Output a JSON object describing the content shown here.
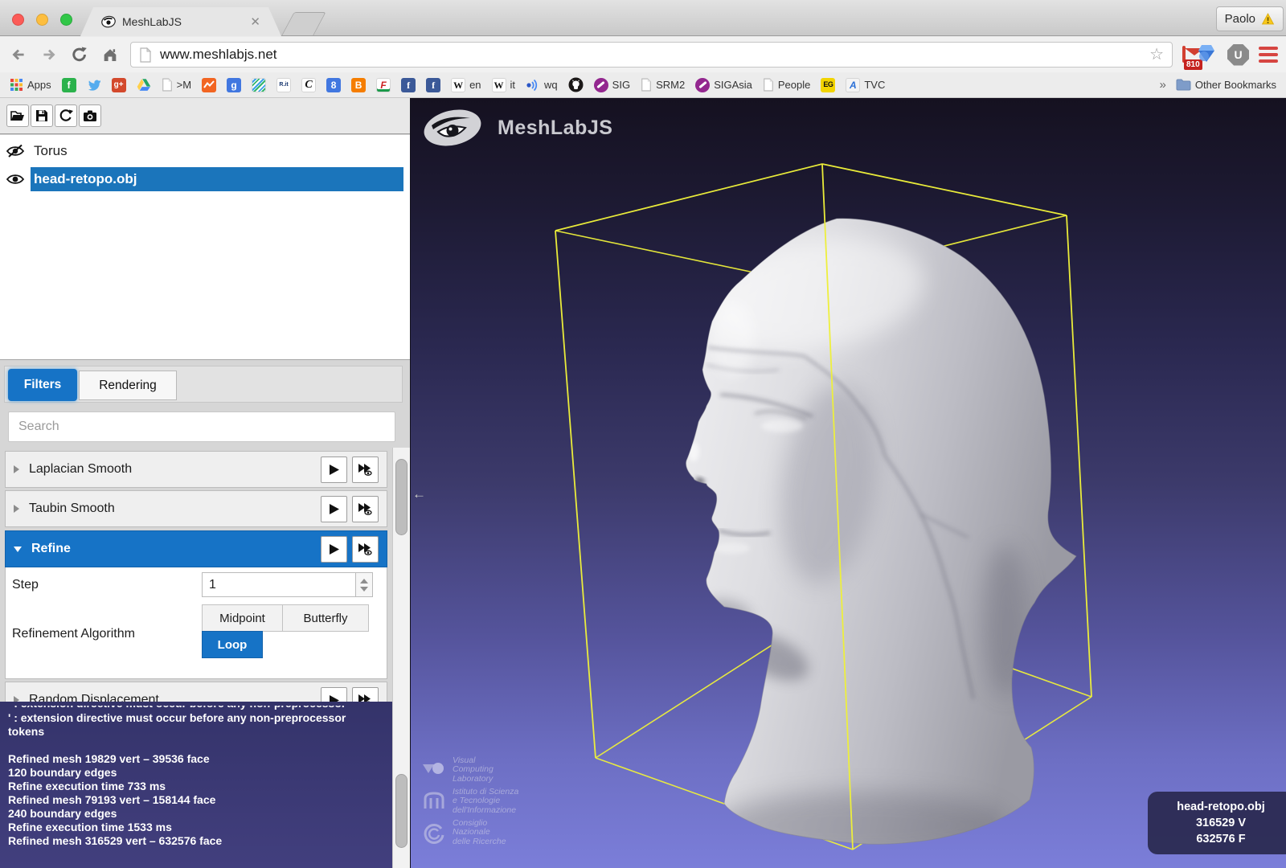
{
  "colors": {
    "accent_blue": "#1673c6",
    "selection_blue": "#1b75bb",
    "bbox_yellow": "#eef03a",
    "log_bg": "#38366e",
    "viewport_top": "#151120",
    "viewport_bottom": "#7b7ed9"
  },
  "browser": {
    "tab_title": "MeshLabJS",
    "url": "www.meshlabjs.net",
    "profile_label": "Paolo",
    "gmail_badge": "810",
    "ublock_letter": "U",
    "overflow_chevron": "»",
    "bookmarks": [
      {
        "icon": "apps-grid",
        "label": "Apps"
      },
      {
        "icon": "feedly",
        "glyph": "f"
      },
      {
        "icon": "twitter"
      },
      {
        "icon": "google-plus",
        "glyph": "g+"
      },
      {
        "icon": "google-drive"
      },
      {
        "icon": "doc",
        "label": ">M"
      },
      {
        "icon": "analytics"
      },
      {
        "icon": "google-g",
        "glyph": "g"
      },
      {
        "icon": "stripes"
      },
      {
        "icon": "repubblica",
        "glyph": "R.it"
      },
      {
        "icon": "corriere",
        "glyph": "C"
      },
      {
        "icon": "google-8",
        "glyph": "8"
      },
      {
        "icon": "blogger",
        "glyph": "B"
      },
      {
        "icon": "trenitalia",
        "glyph": "F"
      },
      {
        "icon": "facebook",
        "glyph": "f"
      },
      {
        "icon": "facebook",
        "glyph": "f"
      },
      {
        "icon": "wikipedia",
        "glyph": "W",
        "label": "en"
      },
      {
        "icon": "wikipedia",
        "glyph": "W",
        "label": "it"
      },
      {
        "icon": "audio",
        "label": "wq"
      },
      {
        "icon": "github"
      },
      {
        "icon": "siggraph",
        "label": "SIG"
      },
      {
        "icon": "doc",
        "label": "SRM2"
      },
      {
        "icon": "siggraph",
        "label": "SIGAsia"
      },
      {
        "icon": "doc",
        "label": "People"
      },
      {
        "icon": "eurographics",
        "glyph": "EG"
      },
      {
        "icon": "tvc",
        "glyph": "A",
        "label": "TVC"
      },
      {
        "icon": "folder",
        "label": "Other Bookmarks"
      }
    ]
  },
  "app": {
    "layers": [
      {
        "name": "Torus",
        "visible": false
      },
      {
        "name": "head-retopo.obj",
        "visible": true,
        "selected": true
      }
    ],
    "tabs": {
      "filters": "Filters",
      "rendering": "Rendering"
    },
    "search_placeholder": "Search",
    "filters": {
      "laplacian": "Laplacian Smooth",
      "taubin": "Taubin Smooth",
      "refine": "Refine",
      "random_displacement": "Random Displacement"
    },
    "refine": {
      "step_label": "Step",
      "step_value": "1",
      "algorithm_label": "Refinement Algorithm",
      "midpoint": "Midpoint",
      "butterfly": "Butterfly",
      "loop": "Loop",
      "selected": "Loop"
    },
    "log": {
      "clipped_line": "' : extension directive must occur before any non-preprocessor tokens",
      "lines": [
        "' : extension directive must occur before any non-preprocessor tokens",
        "",
        "Refined mesh 19829 vert – 39536 face",
        "120 boundary edges",
        "Refine execution time 733 ms",
        "Refined mesh 79193 vert – 158144 face",
        "240 boundary edges",
        "Refine execution time 1533 ms",
        "Refined mesh 316529 vert – 632576 face"
      ]
    },
    "viewport": {
      "brand": "MeshLabJS",
      "credits": [
        {
          "name": "visual-computing-lab",
          "lines": [
            "Visual",
            "Computing",
            "Laboratory"
          ]
        },
        {
          "name": "isti",
          "lines": [
            "Istituto di Scienza",
            "e Tecnologie",
            "dell'Informazione"
          ]
        },
        {
          "name": "cnr",
          "lines": [
            "Consiglio",
            "Nazionale",
            "delle Ricerche"
          ]
        }
      ],
      "info_box": {
        "filename": "head-retopo.obj",
        "vertices": "316529 V",
        "faces": "632576 F"
      }
    }
  }
}
